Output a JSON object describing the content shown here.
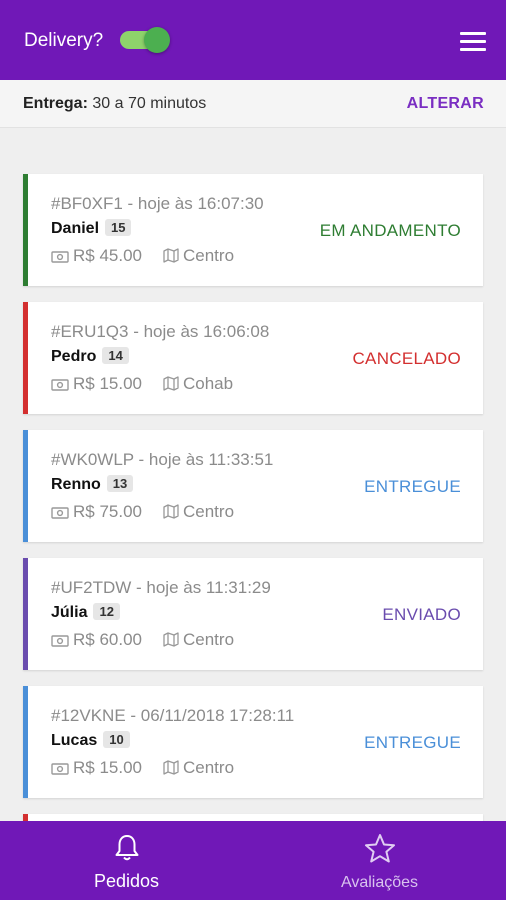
{
  "header": {
    "delivery_label": "Delivery?",
    "delivery_enabled": true,
    "menu_icon": "hamburger-menu-icon",
    "colors": {
      "primary": "#7018b7",
      "toggle_on": "#4caf50"
    }
  },
  "delivery_time": {
    "label": "Entrega:",
    "value": "30 a 70 minutos",
    "change_label": "ALTERAR"
  },
  "orders": [
    {
      "code": "#BF0XF1 - hoje às 16:07:30",
      "name": "Daniel",
      "count": "15",
      "price": "R$ 45.00",
      "neighborhood": "Centro",
      "status": "EM ANDAMENTO",
      "status_color": "#2e7d32",
      "border_color": "#2e7d32"
    },
    {
      "code": "#ERU1Q3 - hoje às 16:06:08",
      "name": "Pedro",
      "count": "14",
      "price": "R$ 15.00",
      "neighborhood": "Cohab",
      "status": "CANCELADO",
      "status_color": "#d32f2f",
      "border_color": "#d32f2f"
    },
    {
      "code": "#WK0WLP - hoje às 11:33:51",
      "name": "Renno",
      "count": "13",
      "price": "R$ 75.00",
      "neighborhood": "Centro",
      "status": "ENTREGUE",
      "status_color": "#4a8fd8",
      "border_color": "#4a8fd8"
    },
    {
      "code": "#UF2TDW - hoje às 11:31:29",
      "name": "Júlia",
      "count": "12",
      "price": "R$ 60.00",
      "neighborhood": "Centro",
      "status": "ENVIADO",
      "status_color": "#6a4cae",
      "border_color": "#6a4cae"
    },
    {
      "code": "#12VKNE - 06/11/2018 17:28:11",
      "name": "Lucas",
      "count": "10",
      "price": "R$ 15.00",
      "neighborhood": "Centro",
      "status": "ENTREGUE",
      "status_color": "#4a8fd8",
      "border_color": "#4a8fd8"
    }
  ],
  "bottom_nav": {
    "tabs": [
      {
        "label": "Pedidos",
        "icon": "bell-icon",
        "active": true
      },
      {
        "label": "Avaliações",
        "icon": "star-icon",
        "active": false
      }
    ]
  }
}
